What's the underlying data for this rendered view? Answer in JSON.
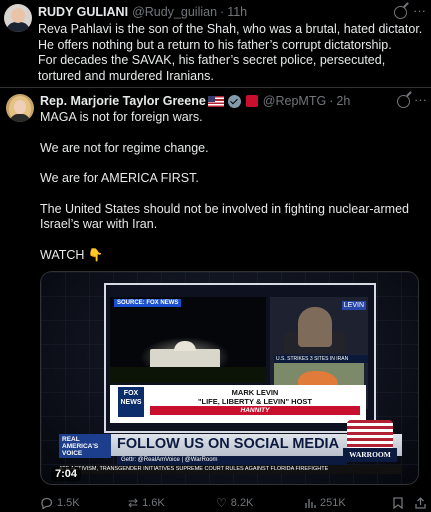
{
  "top_tweet": {
    "author_name": "RUDY GULIANI",
    "handle": "@Rudy_guilian",
    "separator": "·",
    "time": "11h",
    "lines": [
      "Reva Pahlavi is the son of the Shah, who was a brutal, hated dictator.",
      "He offers nothing but a return to his father’s  corrupt dictatorship.",
      "For decades the SAVAK, his father’s secret police, persecuted, tortured and murdered Iranians."
    ]
  },
  "main_tweet": {
    "author_name": "Rep. Marjorie Taylor Greene",
    "handle": "@RepMTG",
    "separator": "·",
    "time": "2h",
    "paragraphs": [
      "MAGA is not for foreign wars.",
      "We are not for regime change.",
      "We are for AMERICA FIRST.",
      "The United States should not be involved in fighting nuclear-armed Israel’s war with Iran.",
      "WATCH 👇"
    ]
  },
  "video": {
    "timestamp": "7:04",
    "source_tag": "SOURCE: FOX NEWS",
    "channel_logo": "LEVIN",
    "map_caption": "U.S. STRIKES 3 SITES IN IRAN",
    "fox_logo": "FOX NEWS",
    "lower_third_name": "MARK LEVIN",
    "lower_third_title": "\"LIFE, LIBERTY & LEVIN\" HOST",
    "lower_third_show": "HANNITY",
    "rav_logo": "REAL AMERICA'S VOICE",
    "banner_headline": "FOLLOW US ON SOCIAL MEDIA",
    "banner_handles": "Gettr: @RealAmVoice | @WarRoom",
    "ticker": "ATE ACTIVISM, TRANSGENDER INITIATIVES      SUPREME COURT RULES AGAINST FLORIDA FIREFIGHTE",
    "warroom_logo": "WARROOM"
  },
  "actions": {
    "replies": "1.5K",
    "reposts": "1.6K",
    "likes": "8.2K",
    "views": "251K"
  },
  "icons": {
    "more": "more-icon",
    "grok": "grok-icon",
    "reply": "reply-icon",
    "repost": "repost-icon",
    "like": "like-icon",
    "views": "views-icon",
    "bookmark": "bookmark-icon",
    "share": "share-icon"
  },
  "colors": {
    "background": "#000000",
    "text": "#e7e9ea",
    "muted": "#71767b",
    "divider": "#2f3336"
  }
}
